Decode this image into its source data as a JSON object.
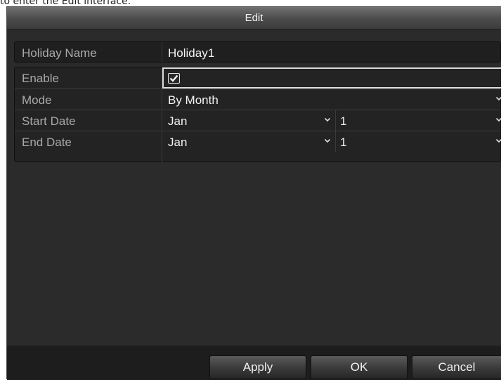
{
  "doc_snippet": "to enter the Edit interface.",
  "dialog": {
    "title": "Edit",
    "fields": {
      "holiday_name": {
        "label": "Holiday Name",
        "value": "Holiday1"
      },
      "enable": {
        "label": "Enable",
        "checked": true
      },
      "mode": {
        "label": "Mode",
        "value": "By Month"
      },
      "start_date": {
        "label": "Start Date",
        "month": "Jan",
        "day": "1"
      },
      "end_date": {
        "label": "End Date",
        "month": "Jan",
        "day": "1"
      }
    },
    "buttons": {
      "apply": "Apply",
      "ok": "OK",
      "cancel": "Cancel"
    }
  },
  "icons": {
    "dropdown": "chevron-down-icon",
    "check": "check-icon"
  },
  "colors": {
    "background": "#2b2b2b",
    "title_bar": "#5a5a5a",
    "label_text": "#a9a9a9",
    "value_text": "#f3f3f3"
  }
}
